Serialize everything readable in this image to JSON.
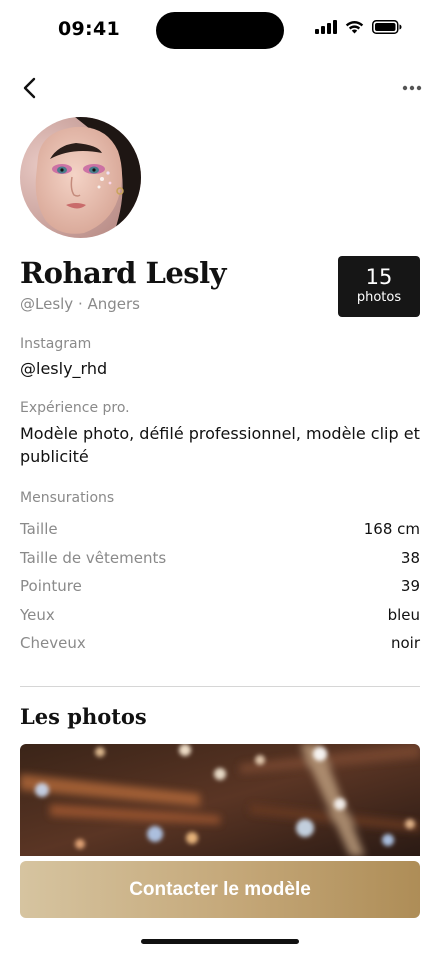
{
  "status_bar": {
    "time": "09:41",
    "icons": [
      "cellular-signal-icon",
      "wifi-icon",
      "battery-icon"
    ]
  },
  "nav": {
    "back_icon": "chevron-left-icon",
    "more_icon": "more-horizontal-icon"
  },
  "profile": {
    "name": "Rohard Lesly",
    "subtitle": "@Lesly · Angers",
    "photos_count": "15",
    "photos_label": "photos"
  },
  "instagram": {
    "label": "Instagram",
    "value": "@lesly_rhd"
  },
  "experience": {
    "label": "Expérience pro.",
    "value": "Modèle photo, défilé professionnel, modèle clip et publicité"
  },
  "measurements": {
    "label": "Mensurations",
    "rows": [
      {
        "key": "Taille",
        "value": "168 cm"
      },
      {
        "key": "Taille de vêtements",
        "value": "38"
      },
      {
        "key": "Pointure",
        "value": "39"
      },
      {
        "key": "Yeux",
        "value": "bleu"
      },
      {
        "key": "Cheveux",
        "value": "noir"
      }
    ]
  },
  "photos_section": {
    "title": "Les photos"
  },
  "cta": {
    "label": "Contacter le modèle"
  },
  "colors": {
    "badge_bg": "#161616",
    "cta_gradient_start": "#d6c4a0",
    "cta_gradient_end": "#ae8d57",
    "muted_text": "#8a8a8a"
  }
}
